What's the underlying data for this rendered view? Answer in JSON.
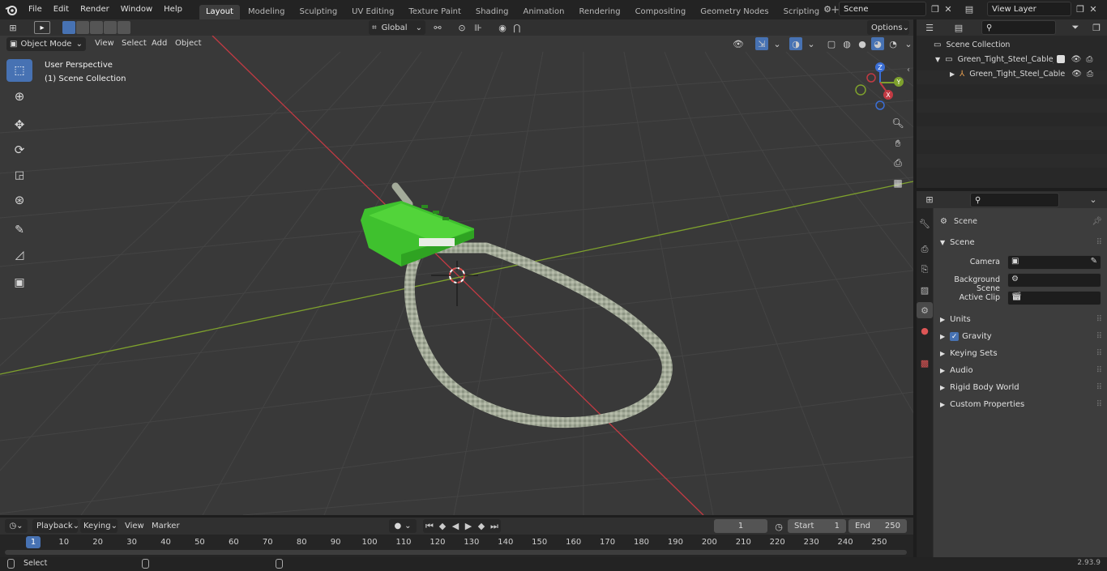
{
  "menu": {
    "file": "File",
    "edit": "Edit",
    "render": "Render",
    "window": "Window",
    "help": "Help"
  },
  "workspaces": [
    "Layout",
    "Modeling",
    "Sculpting",
    "UV Editing",
    "Texture Paint",
    "Shading",
    "Animation",
    "Rendering",
    "Compositing",
    "Geometry Nodes",
    "Scripting"
  ],
  "scene_name": "Scene",
  "view_layer": "View Layer",
  "viewport_header": {
    "mode": "Object Mode",
    "view": "View",
    "select": "Select",
    "add": "Add",
    "object": "Object",
    "transform_orientation": "Global",
    "options": "Options"
  },
  "viewport_overlay": {
    "perspective": "User Perspective",
    "collection": "(1) Scene Collection"
  },
  "gizmo": {
    "x": "X",
    "y": "Y",
    "z": "Z"
  },
  "outliner": {
    "root": "Scene Collection",
    "collection": "Green_Tight_Steel_Cable_Sea",
    "object": "Green_Tight_Steel_Cable"
  },
  "properties": {
    "title": "Scene",
    "section_scene": "Scene",
    "camera_label": "Camera",
    "bg_scene_label": "Background Scene",
    "active_clip_label": "Active Clip",
    "sections": [
      "Units",
      "Gravity",
      "Keying Sets",
      "Audio",
      "Rigid Body World",
      "Custom Properties"
    ]
  },
  "timeline": {
    "playback": "Playback",
    "keying": "Keying",
    "view": "View",
    "marker": "Marker",
    "current_frame": "1",
    "start_label": "Start",
    "start": "1",
    "end_label": "End",
    "end": "250",
    "playhead": "1",
    "ticks": [
      "10",
      "20",
      "30",
      "40",
      "50",
      "60",
      "70",
      "80",
      "90",
      "100",
      "110",
      "120",
      "130",
      "140",
      "150",
      "160",
      "170",
      "180",
      "190",
      "200",
      "210",
      "220",
      "230",
      "240",
      "250"
    ]
  },
  "statusbar": {
    "select": "Select",
    "version": "2.93.9"
  },
  "colors": {
    "accent": "#4772b3",
    "object": "#3fc12e",
    "x_axis": "#c23a43",
    "y_axis": "#7ea12d"
  }
}
